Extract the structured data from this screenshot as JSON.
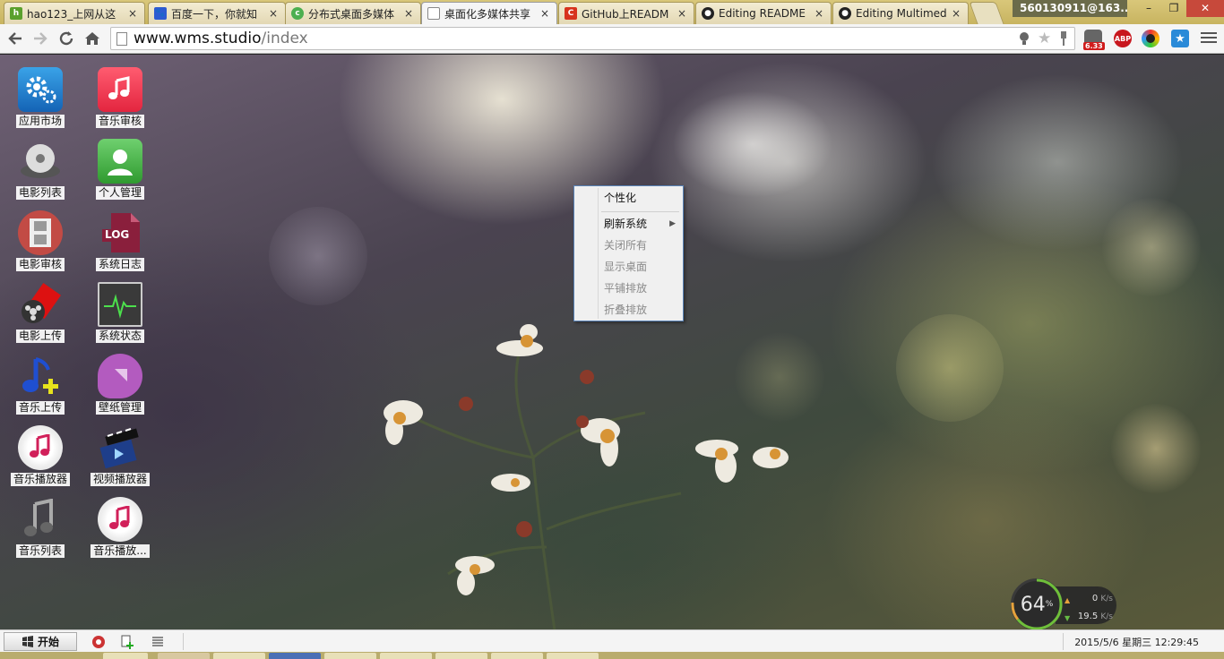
{
  "browser": {
    "tabs": [
      {
        "title": "hao123_上网从这",
        "close": "×",
        "favicon": "hao123-icon",
        "color": "#5aa02c"
      },
      {
        "title": "百度一下，你就知",
        "close": "×",
        "favicon": "baidu-paw-icon",
        "color": "#2d5bd1"
      },
      {
        "title": "分布式桌面多媒体",
        "close": "×",
        "favicon": "chrome-store-icon",
        "color": "#4caf50"
      },
      {
        "title": "桌面化多媒体共享",
        "close": "×",
        "favicon": "page-icon",
        "color": "#ffffff",
        "active": true
      },
      {
        "title": "GitHub上READM",
        "close": "×",
        "favicon": "csdn-icon",
        "color": "#d7321c"
      },
      {
        "title": "Editing README",
        "close": "×",
        "favicon": "github-icon",
        "color": "#222222"
      },
      {
        "title": "Editing Multimed",
        "close": "×",
        "favicon": "github-icon",
        "color": "#222222"
      }
    ],
    "account": "560130911@163....",
    "window_controls": {
      "minimize": "–",
      "maximize": "❐",
      "close": "✕"
    },
    "url_host": "www.wms.studio",
    "url_path": "/index",
    "extension_badge": "6.33"
  },
  "desktop": {
    "icons": [
      {
        "label": "应用市场",
        "icon": "gear-icon"
      },
      {
        "label": "音乐审核",
        "icon": "music-note-icon"
      },
      {
        "label": "电影列表",
        "icon": "disc-drive-icon"
      },
      {
        "label": "个人管理",
        "icon": "user-icon"
      },
      {
        "label": "电影审核",
        "icon": "film-strip-icon"
      },
      {
        "label": "系统日志",
        "icon": "log-file-icon",
        "text": "LOG"
      },
      {
        "label": "电影上传",
        "icon": "film-reel-icon"
      },
      {
        "label": "系统状态",
        "icon": "heartbeat-monitor-icon"
      },
      {
        "label": "音乐上传",
        "icon": "music-upload-icon"
      },
      {
        "label": "壁纸管理",
        "icon": "wallpaper-icon"
      },
      {
        "label": "音乐播放器",
        "icon": "music-player-icon"
      },
      {
        "label": "视频播放器",
        "icon": "video-player-icon"
      },
      {
        "label": "音乐列表",
        "icon": "music-list-icon"
      },
      {
        "label": "音乐播放...",
        "icon": "music-player-icon"
      }
    ],
    "context_menu": [
      {
        "label": "个性化",
        "enabled": true
      },
      {
        "label": "刷新系统",
        "enabled": true,
        "submenu": true,
        "arrow": "▶"
      },
      {
        "label": "关闭所有",
        "enabled": false
      },
      {
        "label": "显示桌面",
        "enabled": false
      },
      {
        "label": "平铺排放",
        "enabled": false
      },
      {
        "label": "折叠排放",
        "enabled": false
      }
    ],
    "net_monitor": {
      "cpu_percent": "64",
      "cpu_unit": "%",
      "upload_value": "0",
      "upload_unit": "K/s",
      "download_value": "19.5",
      "download_unit": "K/s"
    }
  },
  "taskbar": {
    "start_label": "开始",
    "clock": "2015/5/6 星期三 12:29:45"
  }
}
